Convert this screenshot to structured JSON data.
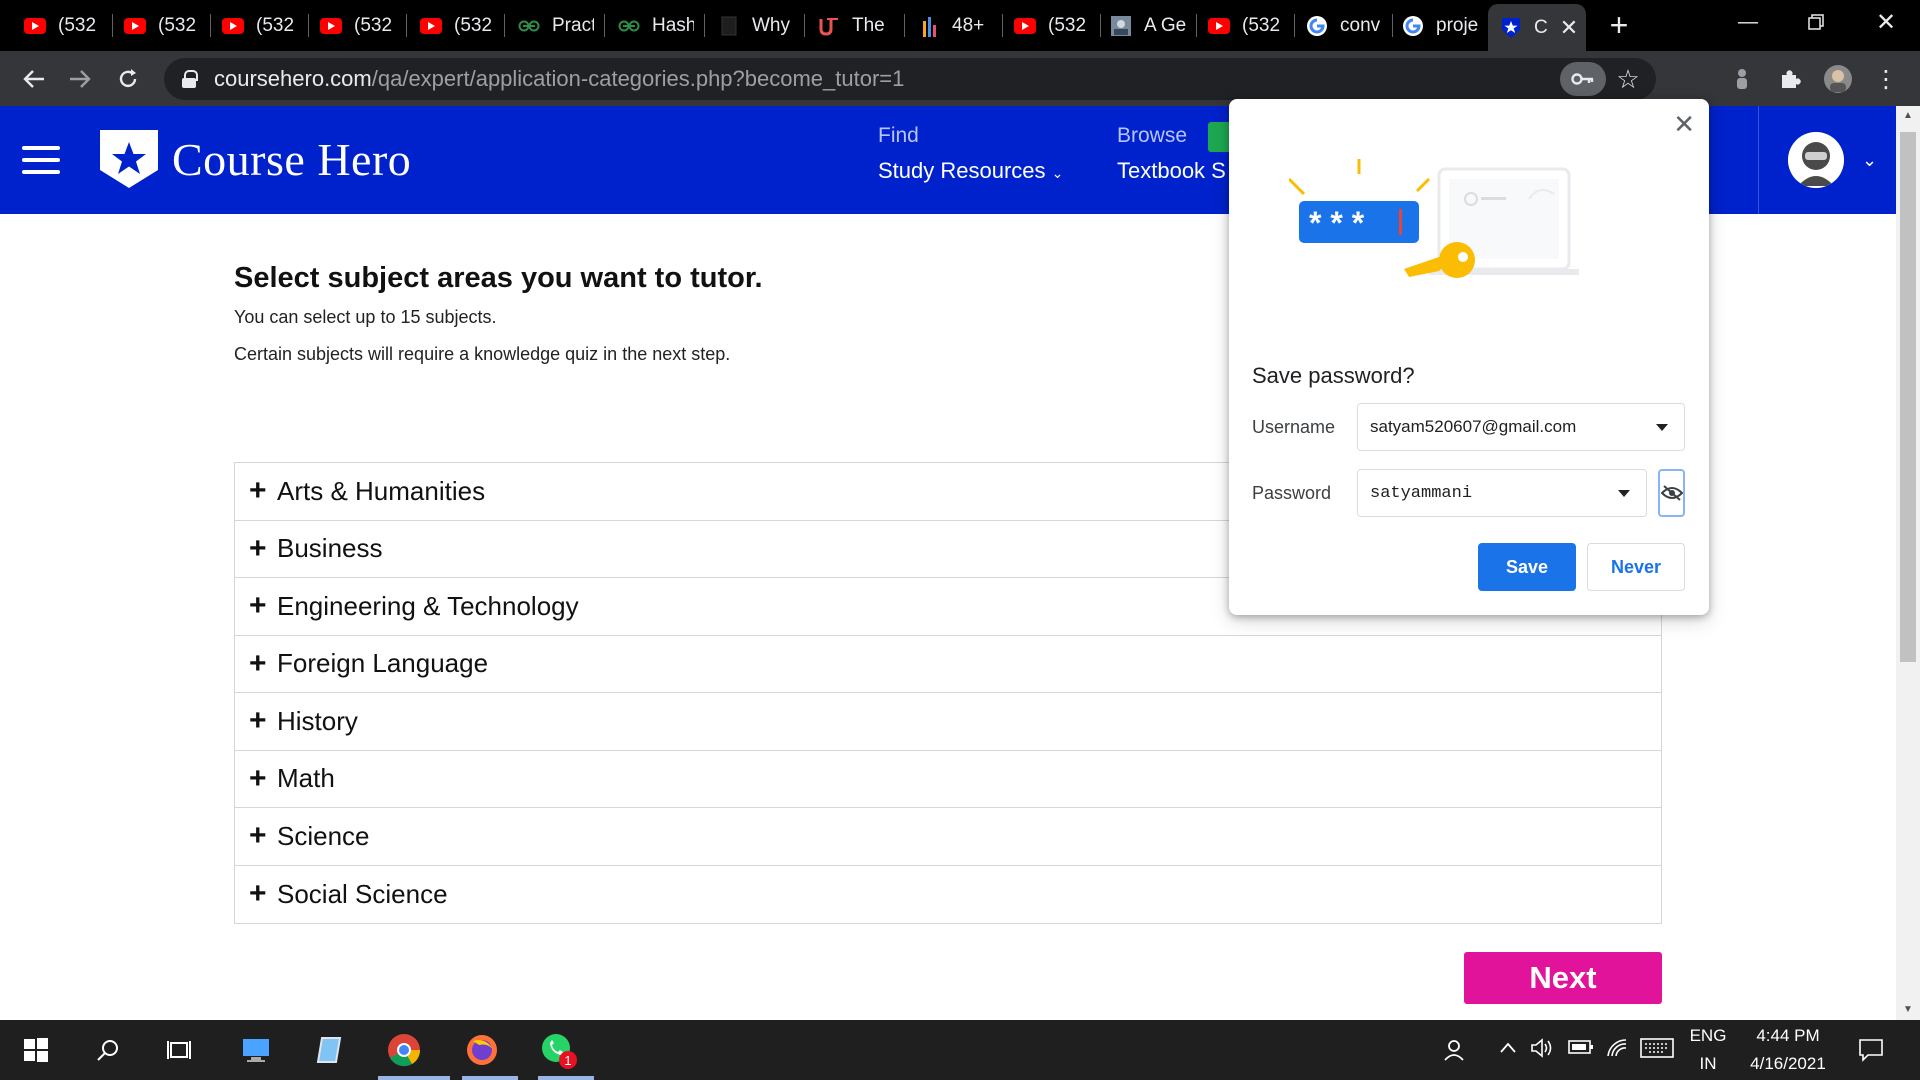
{
  "browser": {
    "tabs": [
      {
        "icon": "youtube-icon",
        "title": "(532"
      },
      {
        "icon": "youtube-icon",
        "title": "(532"
      },
      {
        "icon": "youtube-icon",
        "title": "(532"
      },
      {
        "icon": "youtube-icon",
        "title": "(532"
      },
      {
        "icon": "youtube-icon",
        "title": "(532"
      },
      {
        "icon": "geeksforgeeks-icon",
        "title": "Pract"
      },
      {
        "icon": "geeksforgeeks-icon",
        "title": "Hash"
      },
      {
        "icon": "page-icon",
        "title": "Why"
      },
      {
        "icon": "udemy-icon",
        "title": "The"
      },
      {
        "icon": "chart-icon",
        "title": "48+"
      },
      {
        "icon": "youtube-icon",
        "title": "(532"
      },
      {
        "icon": "image-icon",
        "title": "A Ge"
      },
      {
        "icon": "youtube-icon",
        "title": "(532"
      },
      {
        "icon": "google-icon",
        "title": "conv"
      },
      {
        "icon": "google-icon",
        "title": "proje"
      },
      {
        "icon": "coursehero-icon",
        "title": "C"
      }
    ],
    "new_tab_label": "+",
    "url_host": "coursehero.com",
    "url_path": "/qa/expert/application-categories.php?become_tutor=1"
  },
  "site": {
    "brand": "Course Hero",
    "nav": [
      {
        "sup": "Find",
        "main": "Study Resources"
      },
      {
        "sup": "Browse",
        "main": "Textbook S"
      }
    ]
  },
  "page": {
    "heading": "Select subject areas you want to tutor.",
    "subtext_1": "You can select up to 15 subjects.",
    "subtext_2": "Certain subjects will require a knowledge quiz in the next step.",
    "subjects": [
      "Arts & Humanities",
      "Business",
      "Engineering & Technology",
      "Foreign Language",
      "History",
      "Math",
      "Science",
      "Social Science"
    ],
    "expand_symbol": "+",
    "next_label": "Next"
  },
  "password_bubble": {
    "title": "Save password?",
    "username_label": "Username",
    "username_value": "satyam520607@gmail.com",
    "password_label": "Password",
    "password_value": "satyammani",
    "save_label": "Save",
    "never_label": "Never",
    "illustration_stars": "* * *"
  },
  "taskbar": {
    "language_1": "ENG",
    "language_2": "IN",
    "time": "4:44 PM",
    "date": "4/16/2021",
    "whatsapp_badge": "1"
  },
  "colors": {
    "brand_blue": "#0022cc",
    "next_pink": "#e1139a",
    "chrome_blue": "#1a73e8"
  }
}
